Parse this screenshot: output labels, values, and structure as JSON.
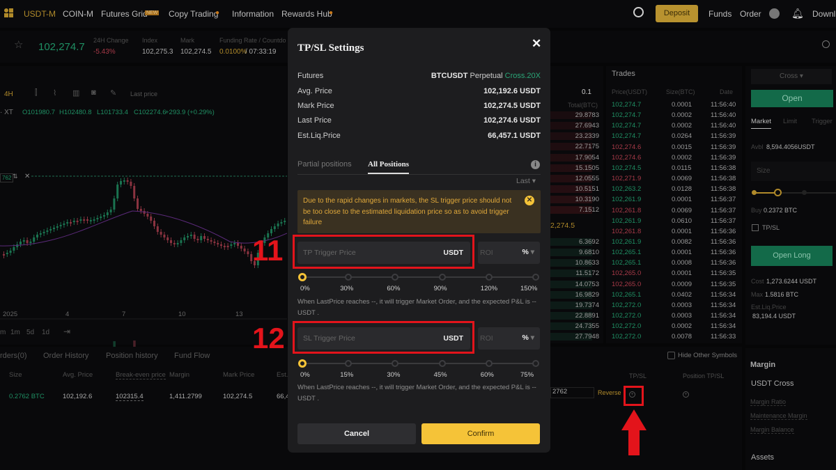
{
  "nav": {
    "items": [
      "USDT-M",
      "COIN-M",
      "Futures Grid",
      "Copy Trading",
      "Information",
      "Rewards Hub"
    ],
    "new_badge": "NEW",
    "deposit": "Deposit",
    "funds": "Funds",
    "order": "Order",
    "download": "Downl"
  },
  "ticker": {
    "price": "102,274.7",
    "change_label": "24H Change",
    "change": "-5.43%",
    "index_label": "Index",
    "index": "102,275.3",
    "mark_label": "Mark",
    "mark": "102,274.5",
    "funding_label": "Funding Rate / Countdo",
    "funding_rate": "0.0100%",
    "countdown": "/ 07:33:19"
  },
  "chart": {
    "interval": "4H",
    "price_type": "Last price",
    "symbol": "· XT",
    "ohlc": {
      "o": "O101980.7",
      "h": "H102480.8",
      "l": "L101733.4",
      "c": "C102274.6",
      "chg": "+293.9 (+0.29%)"
    },
    "position_tag": "762",
    "dates": [
      "2025",
      "4",
      "7",
      "10",
      "13"
    ],
    "ranges": [
      "1m",
      "5d",
      "1d"
    ],
    "first_range": "m"
  },
  "bottom": {
    "tabs": [
      "rders(0)",
      "Order History",
      "Position history",
      "Fund Flow"
    ],
    "headers": [
      "Size",
      "Avg. Price",
      "Break-even price",
      "Margin",
      "Mark Price",
      "Est."
    ],
    "row": [
      "0.2762 BTC",
      "102,192.6",
      "102315.4",
      "1,411.2799",
      "102,274.5",
      "66,4"
    ],
    "hide_other": "Hide Other Symbols",
    "tpsl_header": "TP/SL",
    "pos_tpsl_header": "Position TP/SL",
    "close_qty": "2762",
    "reverse": "Reverse"
  },
  "orderbook": {
    "step": "0.1",
    "total_header": "Total(BTC)",
    "asks": [
      "29.8783",
      "27.6943",
      "23.2339",
      "22.7175",
      "17.9054",
      "15.1505",
      "12.0555",
      "10.5151",
      "10.3190",
      "7.1512"
    ],
    "mid": "2,274.5",
    "bids": [
      "6.3692",
      "9.6810",
      "10.8633",
      "11.5172",
      "14.0753",
      "16.9829",
      "19.7374",
      "22.8891",
      "24.7355",
      "27.7948"
    ]
  },
  "trades": {
    "title": "Trades",
    "headers": [
      "Price(USDT)",
      "Size(BTC)",
      "Date"
    ],
    "rows": [
      [
        "102,274.7",
        "0.0001",
        "11:56:40",
        "up"
      ],
      [
        "102,274.7",
        "0.0002",
        "11:56:40",
        "up"
      ],
      [
        "102,274.7",
        "0.0002",
        "11:56:40",
        "up"
      ],
      [
        "102,274.7",
        "0.0264",
        "11:56:39",
        "up"
      ],
      [
        "102,274.6",
        "0.0015",
        "11:56:39",
        "down"
      ],
      [
        "102,274.6",
        "0.0002",
        "11:56:39",
        "down"
      ],
      [
        "102,274.5",
        "0.0115",
        "11:56:38",
        "up"
      ],
      [
        "102,271.9",
        "0.0069",
        "11:56:38",
        "down"
      ],
      [
        "102,263.2",
        "0.0128",
        "11:56:38",
        "up"
      ],
      [
        "102,261.9",
        "0.0001",
        "11:56:37",
        "up"
      ],
      [
        "102,261.8",
        "0.0069",
        "11:56:37",
        "down"
      ],
      [
        "102,261.9",
        "0.0610",
        "11:56:37",
        "up"
      ],
      [
        "102,261.8",
        "0.0001",
        "11:56:36",
        "down"
      ],
      [
        "102,261.9",
        "0.0082",
        "11:56:36",
        "up"
      ],
      [
        "102,265.1",
        "0.0001",
        "11:56:36",
        "up"
      ],
      [
        "102,265.1",
        "0.0008",
        "11:56:36",
        "up"
      ],
      [
        "102,265.0",
        "0.0001",
        "11:56:35",
        "down"
      ],
      [
        "102,265.0",
        "0.0009",
        "11:56:35",
        "down"
      ],
      [
        "102,265.1",
        "0.0402",
        "11:56:34",
        "up"
      ],
      [
        "102,272.0",
        "0.0003",
        "11:56:34",
        "up"
      ],
      [
        "102,272.0",
        "0.0003",
        "11:56:34",
        "up"
      ],
      [
        "102,272.0",
        "0.0002",
        "11:56:34",
        "up"
      ],
      [
        "102,272.0",
        "0.0078",
        "11:56:33",
        "up"
      ]
    ]
  },
  "trade_panel": {
    "margin_mode": "Cross",
    "open": "Open",
    "tabs": [
      "Market",
      "Limit",
      "Trigger"
    ],
    "avbl_label": "Avbl",
    "avbl": "8,594.4056USDT",
    "size_placeholder": "Size",
    "buy_label": "Buy",
    "buy": "0.2372 BTC",
    "tpsl": "TP/SL",
    "open_long": "Open Long",
    "cost_label": "Cost",
    "cost": "1,273.6244 USDT",
    "max_label": "Max",
    "max": "1.5816 BTC",
    "liq_label": "Est.Liq.Price",
    "liq": "83,194.4 USDT",
    "margin_title": "Margin",
    "margin_account": "USDT Cross",
    "margin_items": [
      "Margin Ratio",
      "Maintenance Margin",
      "Margin Balance"
    ],
    "assets": "Assets"
  },
  "modal": {
    "title": "TP/SL Settings",
    "rows": [
      {
        "label": "Futures",
        "symbol": "BTCUSDT",
        "type": "Perpetual",
        "mode": "Cross.20X"
      },
      {
        "label": "Avg. Price",
        "value": "102,192.6 USDT"
      },
      {
        "label": "Mark Price",
        "value": "102,274.5 USDT"
      },
      {
        "label": "Last Price",
        "value": "102,274.6 USDT"
      },
      {
        "label": "Est.Liq.Price",
        "value": "66,457.1 USDT"
      }
    ],
    "tabs": [
      "Partial positions",
      "All Positions"
    ],
    "active_tab": "All Positions",
    "trigger_type": "Last",
    "warning": "Due to the rapid changes in markets, the SL trigger price should not be too close to the estimated liquidation price so as to avoid trigger failure",
    "tp": {
      "placeholder": "TP Trigger Price",
      "unit": "USDT",
      "roi": "ROI",
      "roi_unit": "%",
      "steps": [
        "0%",
        "30%",
        "60%",
        "90%",
        "120%",
        "150%"
      ],
      "value_fraction": 0,
      "note": "When LastPrice reaches --, it will trigger Market Order, and the expected P&L is -- USDT ."
    },
    "sl": {
      "placeholder": "SL Trigger Price",
      "unit": "USDT",
      "roi": "ROI",
      "roi_unit": "%",
      "steps": [
        "0%",
        "15%",
        "30%",
        "45%",
        "60%",
        "75%"
      ],
      "value_fraction": 0,
      "note": "When LastPrice reaches --, it will trigger Market Order, and the expected P&L is -- USDT ."
    },
    "cancel": "Cancel",
    "confirm": "Confirm"
  },
  "annotations": {
    "step_tp": "11",
    "step_sl": "12",
    "color": "#e3141b"
  },
  "colors": {
    "accent": "#f5c338",
    "up": "#1f8f63",
    "down": "#a83a48"
  }
}
